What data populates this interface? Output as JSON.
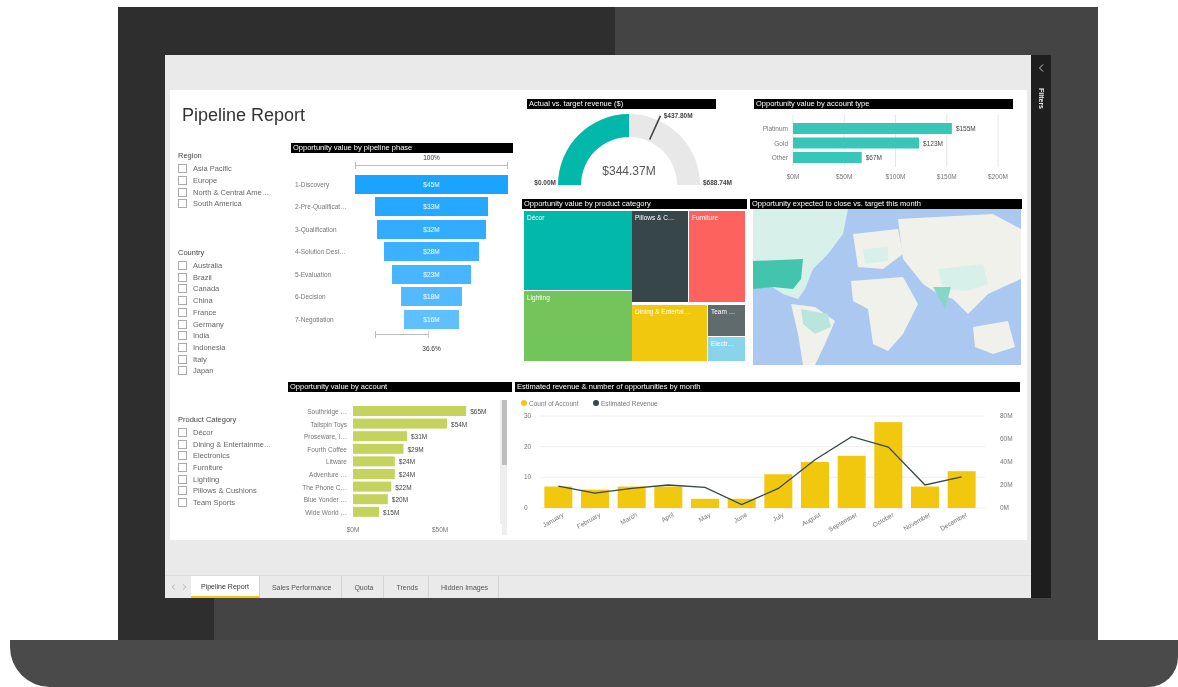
{
  "report": {
    "title": "Pipeline Report"
  },
  "slicers": [
    {
      "title": "Region",
      "items": [
        {
          "label": "Asia Pacific",
          "checked": false
        },
        {
          "label": "Europe",
          "checked": false
        },
        {
          "label": "North & Central Ame…",
          "checked": false
        },
        {
          "label": "South America",
          "checked": false
        }
      ]
    },
    {
      "title": "Country",
      "items": [
        {
          "label": "Australia",
          "checked": false
        },
        {
          "label": "Brazil",
          "checked": false
        },
        {
          "label": "Canada",
          "checked": false
        },
        {
          "label": "China",
          "checked": false
        },
        {
          "label": "France",
          "checked": false
        },
        {
          "label": "Germany",
          "checked": false
        },
        {
          "label": "India",
          "checked": false
        },
        {
          "label": "Indonesia",
          "checked": false
        },
        {
          "label": "Italy",
          "checked": false
        },
        {
          "label": "Japan",
          "checked": false
        }
      ]
    },
    {
      "title": "Product Category",
      "items": [
        {
          "label": "Décor",
          "checked": false
        },
        {
          "label": "Dining & Entertainme…",
          "checked": false
        },
        {
          "label": "Electronics",
          "checked": false
        },
        {
          "label": "Furniture",
          "checked": false
        },
        {
          "label": "Lighting",
          "checked": false
        },
        {
          "label": "Pillows & Cushions",
          "checked": false
        },
        {
          "label": "Team Sports",
          "checked": false
        }
      ]
    }
  ],
  "funnel": {
    "title": "Opportunity value by pipeline phase",
    "top_label": "100%",
    "bottom_label": "36.6%",
    "stages": [
      {
        "label": "1-Discovery",
        "value": "$45M"
      },
      {
        "label": "2-Pre-Qualificat…",
        "value": "$33M"
      },
      {
        "label": "3-Qualification",
        "value": "$32M"
      },
      {
        "label": "4-Solution Desi…",
        "value": "$28M"
      },
      {
        "label": "5-Evaluation",
        "value": "$23M"
      },
      {
        "label": "6-Decision",
        "value": "$18M"
      },
      {
        "label": "7-Negotiation",
        "value": "$16M"
      }
    ]
  },
  "gauge": {
    "title": "Actual vs. target  revenue ($)",
    "value": "$344.37M",
    "min": "$0.00M",
    "max": "$688.74M",
    "target": "$437.80M",
    "level": 0.5
  },
  "account_type": {
    "chart_data": {
      "type": "bar",
      "title": "Opportunity value by account type",
      "orientation": "horizontal",
      "categories": [
        "Platinum",
        "Gold",
        "Other"
      ],
      "series": [
        {
          "color": "#37c6b7",
          "values": [
            155,
            123,
            67
          ]
        }
      ],
      "value_labels": [
        "$155M",
        "$123M",
        "$67M"
      ],
      "xlim": [
        0,
        200
      ],
      "grid": true,
      "xticks": [
        {
          "value": 0,
          "label": "$0M"
        },
        {
          "value": 50,
          "label": "$50M"
        },
        {
          "value": 100,
          "label": "$100M"
        },
        {
          "value": 150,
          "label": "$150M"
        },
        {
          "value": 200,
          "label": "$200M"
        }
      ]
    }
  },
  "treemap": {
    "title": "Opportunity value by product category",
    "items": [
      {
        "label": "Décor",
        "color": "#01b8aa"
      },
      {
        "label": "Lighting",
        "color": "#73c45a"
      },
      {
        "label": "Pillows & C…",
        "color": "#374649"
      },
      {
        "label": "Furniture",
        "color": "#fd625e"
      },
      {
        "label": "Dining & Entertai…",
        "color": "#f2c80f"
      },
      {
        "label": "Team …",
        "color": "#5f6b6d"
      },
      {
        "label": "Electr…",
        "color": "#8ad4eb"
      }
    ]
  },
  "map": {
    "title": "Opportunity expected to close vs. target this month"
  },
  "accounts": {
    "chart_data": {
      "type": "bar",
      "title": "Opportunity value by account",
      "orientation": "horizontal",
      "categories": [
        "Southridge …",
        "Tailspin Toys",
        "Proseware, I…",
        "Fourth Coffee",
        "Litware",
        "Adventure …",
        "The Phone C…",
        "Blue Yonder …",
        "Wide World …"
      ],
      "series": [
        {
          "color": "#c3d35d",
          "values": [
            65,
            54,
            31,
            29,
            24,
            24,
            22,
            20,
            15
          ]
        }
      ],
      "value_labels": [
        "$65M",
        "$54M",
        "$31M",
        "$29M",
        "$24M",
        "$24M",
        "$22M",
        "$20M",
        "$15M"
      ],
      "xlim": [
        0,
        85
      ],
      "xticks": [
        {
          "value": 0,
          "label": "$0M"
        },
        {
          "value": 50,
          "label": "$50M"
        }
      ]
    }
  },
  "monthly": {
    "chart_data": {
      "type": "bar",
      "title": "Estimated revenue & number of opportunities by month",
      "categories": [
        "January",
        "February",
        "March",
        "April",
        "May",
        "June",
        "July",
        "August",
        "September",
        "October",
        "November",
        "December"
      ],
      "series": [
        {
          "name": "Count of Account",
          "type": "bar",
          "color": "#f2c80f",
          "values": [
            7,
            6,
            7,
            7,
            3,
            3,
            11,
            15,
            17,
            28,
            7,
            12
          ]
        },
        {
          "name": "Estimated Revenue",
          "type": "line",
          "axis": "y2",
          "color": "#374649",
          "values": [
            19,
            13,
            17,
            20,
            18,
            3,
            17,
            42,
            62,
            53,
            20,
            27
          ]
        }
      ],
      "legend": "top left",
      "ylim": [
        0,
        30
      ],
      "y2lim": [
        0,
        80
      ],
      "yticks": [
        0,
        10,
        20,
        30
      ],
      "y2ticks": [
        {
          "value": 0,
          "label": "0M"
        },
        {
          "value": 20,
          "label": "20M"
        },
        {
          "value": 40,
          "label": "40M"
        },
        {
          "value": 60,
          "label": "60M"
        },
        {
          "value": 80,
          "label": "80M"
        }
      ]
    }
  },
  "tabs": [
    {
      "label": "Pipeline Report",
      "selected": true
    },
    {
      "label": "Sales Performance",
      "selected": false
    },
    {
      "label": "Quota",
      "selected": false
    },
    {
      "label": "Trends",
      "selected": false
    },
    {
      "label": "Hidden Images",
      "selected": false
    }
  ],
  "filters_pane": {
    "label": "Filters"
  }
}
